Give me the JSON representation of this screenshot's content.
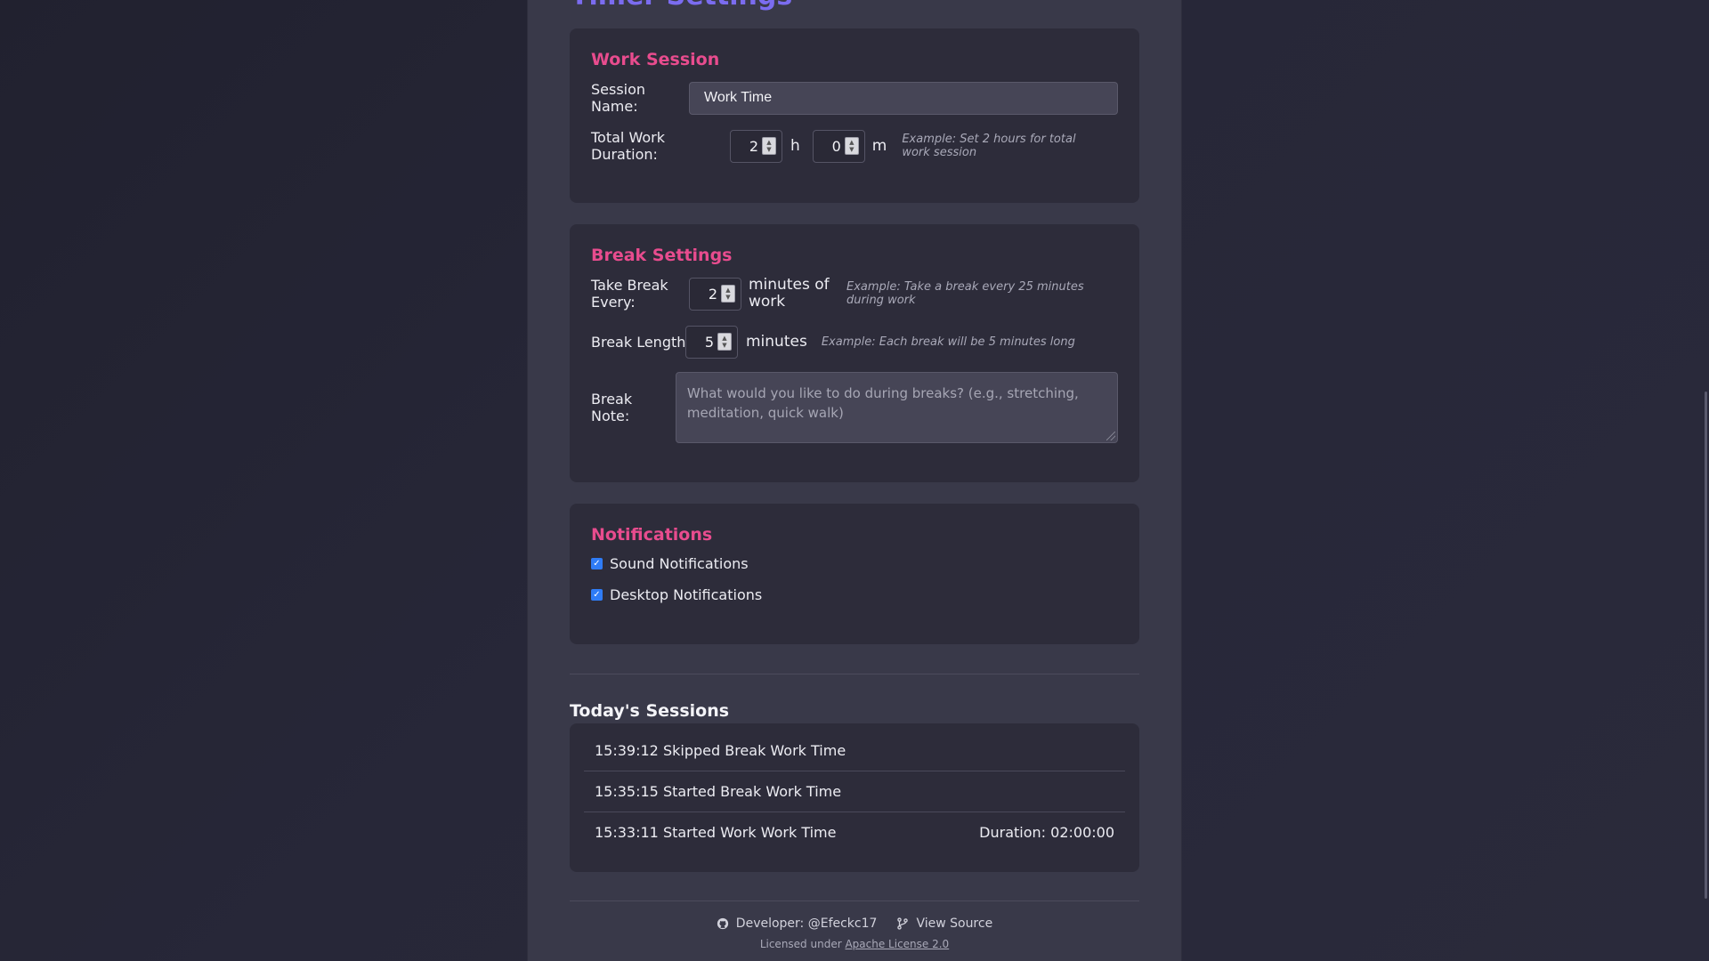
{
  "page": {
    "heading": "Timer Settings"
  },
  "work_session": {
    "title": "Work Session",
    "session_name_label": "Session Name:",
    "session_name_value": "Work Time",
    "duration_label": "Total Work Duration:",
    "hours_value": "2",
    "hours_unit": "h",
    "minutes_value": "0",
    "minutes_unit": "m",
    "duration_hint": "Example: Set 2 hours for total work session"
  },
  "break_settings": {
    "title": "Break Settings",
    "every_label": "Take Break Every:",
    "every_value": "2",
    "every_unit": "minutes of work",
    "every_hint": "Example: Take a break every 25 minutes during work",
    "length_label": "Break Length:",
    "length_value": "5",
    "length_unit": "minutes",
    "length_hint": "Example: Each break will be 5 minutes long",
    "note_label": "Break Note:",
    "note_placeholder": "What would you like to do during breaks? (e.g., stretching, meditation, quick walk)"
  },
  "notifications": {
    "title": "Notifications",
    "items": [
      {
        "label": "Sound Notifications",
        "checked": true
      },
      {
        "label": "Desktop Notifications",
        "checked": true
      }
    ]
  },
  "sessions": {
    "title": "Today's Sessions",
    "rows": [
      {
        "text": "15:39:12 Skipped Break Work Time",
        "duration": ""
      },
      {
        "text": "15:35:15 Started Break Work Time",
        "duration": ""
      },
      {
        "text": "15:33:11 Started Work Work Time",
        "duration": "Duration: 02:00:00"
      }
    ]
  },
  "footer": {
    "developer": "Developer: @Efeckc17",
    "view_source": "View Source",
    "license_prefix": "Licensed under",
    "license_link": "Apache License 2.0"
  },
  "icons": {
    "github": "github-icon",
    "branch": "git-branch-icon",
    "check": "checkmark-icon",
    "spinner": "spinner-arrows-icon"
  },
  "colors": {
    "accent_pink": "#e84c8e",
    "accent_purple": "#7b6cf0",
    "checkbox_blue": "#2f7cf6"
  }
}
